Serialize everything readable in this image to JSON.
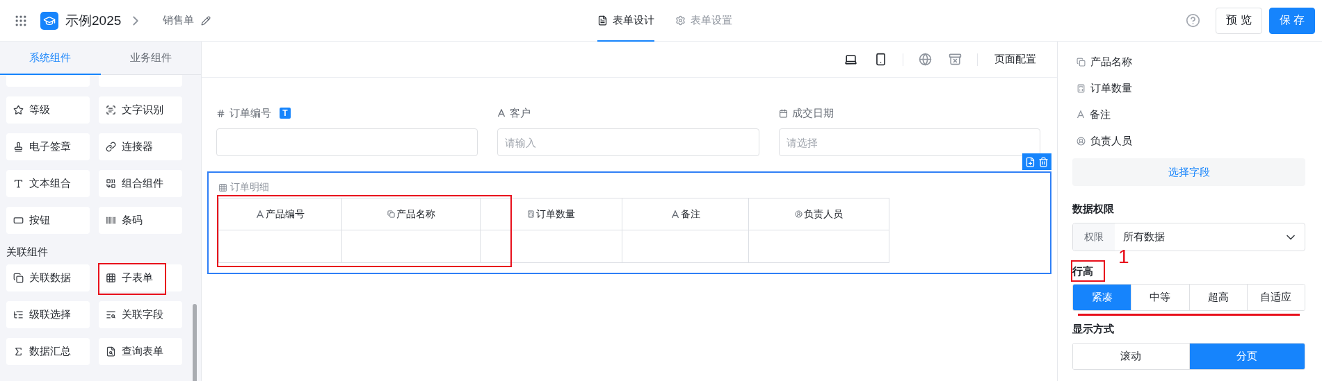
{
  "header": {
    "app_name": "示例2025",
    "page_name": "销售单",
    "tabs": [
      {
        "label": "表单设计",
        "selected": true
      },
      {
        "label": "表单设置",
        "selected": false
      }
    ],
    "preview_button": "预 览",
    "save_button": "保 存"
  },
  "sidebar": {
    "tabs": [
      {
        "label": "系统组件",
        "selected": true
      },
      {
        "label": "业务组件",
        "selected": false
      }
    ],
    "sections": [
      {
        "items": [
          {
            "kind": "blank",
            "annotated": false
          },
          {
            "kind": "blank",
            "annotated": false
          },
          {
            "label": "等级",
            "kind": "star",
            "annotated": false
          },
          {
            "label": "文字识别",
            "kind": "ocr",
            "annotated": false
          },
          {
            "label": "电子签章",
            "kind": "stamp",
            "annotated": false
          },
          {
            "label": "连接器",
            "kind": "link",
            "annotated": false
          },
          {
            "label": "文本组合",
            "kind": "textbox",
            "annotated": false
          },
          {
            "label": "组合组件",
            "kind": "combine",
            "annotated": false
          },
          {
            "label": "按钮",
            "kind": "button",
            "annotated": false
          },
          {
            "label": "条码",
            "kind": "barcode",
            "annotated": false
          }
        ]
      },
      {
        "title": "关联组件",
        "items": [
          {
            "label": "关联数据",
            "kind": "relation",
            "annotated": false
          },
          {
            "label": "子表单",
            "kind": "table",
            "annotated": true
          },
          {
            "label": "级联选择",
            "kind": "cascade",
            "annotated": false
          },
          {
            "label": "关联字段",
            "kind": "search",
            "annotated": false
          },
          {
            "label": "数据汇总",
            "kind": "sum",
            "annotated": false
          },
          {
            "label": "查询表单",
            "kind": "query",
            "annotated": false
          }
        ]
      }
    ]
  },
  "canvas_toolbar": {
    "page_config": "页面配置"
  },
  "form": {
    "fields": [
      {
        "label": "订单编号",
        "kind": "number",
        "badge": "T"
      },
      {
        "label": "客户",
        "kind": "text",
        "placeholder": "请输入"
      },
      {
        "label": "成交日期",
        "kind": "date",
        "placeholder": "请选择"
      }
    ],
    "subtable": {
      "title": "订单明细",
      "selected": true,
      "annotated": true,
      "columns": [
        {
          "label": "产品编号",
          "kind": "text"
        },
        {
          "label": "产品名称",
          "kind": "relation"
        },
        {
          "label": "订单数量",
          "kind": "numeric"
        },
        {
          "label": "备注",
          "kind": "text"
        },
        {
          "label": "负责人员",
          "kind": "user"
        }
      ]
    }
  },
  "properties": {
    "fields": [
      {
        "label": "产品名称",
        "kind": "relation"
      },
      {
        "label": "订单数量",
        "kind": "numeric"
      },
      {
        "label": "备注",
        "kind": "text"
      },
      {
        "label": "负责人员",
        "kind": "user"
      }
    ],
    "select_fields_button": "选择字段",
    "data_permission": {
      "title": "数据权限",
      "label": "权限",
      "value": "所有数据"
    },
    "row_height": {
      "title": "行高",
      "annotated": true,
      "annotation_number": "1",
      "underlined": true,
      "options": [
        {
          "label": "紧凑",
          "selected": true
        },
        {
          "label": "中等",
          "selected": false
        },
        {
          "label": "超高",
          "selected": false
        },
        {
          "label": "自适应",
          "selected": false
        }
      ]
    },
    "display_mode": {
      "title": "显示方式",
      "options": [
        {
          "label": "滚动",
          "selected": false
        },
        {
          "label": "分页",
          "selected": true
        }
      ]
    }
  }
}
